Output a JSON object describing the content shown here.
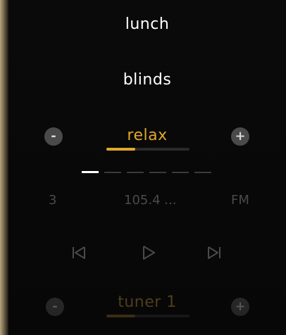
{
  "menu": {
    "item_lunch": "lunch",
    "item_blinds": "blinds"
  },
  "scene": {
    "name": "relax",
    "minus_label": "-",
    "plus_label": "+",
    "level_fraction": 0.35,
    "accent_color": "#e0a82a"
  },
  "pager": {
    "count": 6,
    "active_index": 0
  },
  "tuner": {
    "preset": "3",
    "frequency": "105.4 ...",
    "band": "FM"
  },
  "transport": {
    "prev_icon": "skip-previous-icon",
    "play_icon": "play-icon",
    "next_icon": "skip-next-icon"
  },
  "source": {
    "name": "tuner 1",
    "minus_label": "-",
    "plus_label": "+",
    "level_fraction": 0.35
  }
}
